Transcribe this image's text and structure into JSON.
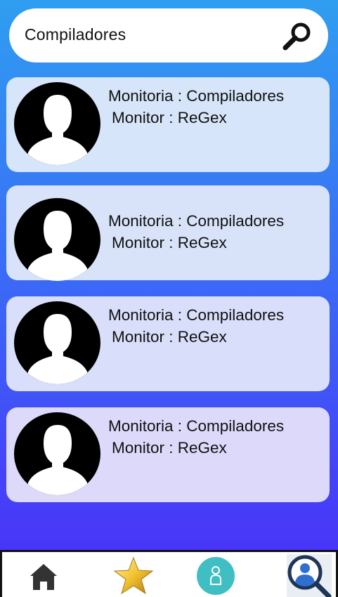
{
  "search": {
    "value": "Compiladores",
    "icon": "search-icon"
  },
  "results": [
    {
      "monitoria": "Monitoria : Compiladores",
      "monitor": "Monitor : ReGex",
      "avatar_icon": "user-avatar-icon"
    },
    {
      "monitoria": "Monitoria : Compiladores",
      "monitor": "Monitor : ReGex",
      "avatar_icon": "user-avatar-icon"
    },
    {
      "monitoria": "Monitoria : Compiladores",
      "monitor": "Monitor : ReGex",
      "avatar_icon": "user-avatar-icon"
    },
    {
      "monitoria": "Monitoria : Compiladores",
      "monitor": "Monitor : ReGex",
      "avatar_icon": "user-avatar-icon"
    }
  ],
  "bottom_nav": {
    "items": [
      "home-icon",
      "star-icon",
      "person-icon",
      "user-search-icon"
    ]
  },
  "colors": {
    "gradient_top": "#2f9ef0",
    "gradient_bottom": "#4b2cf8",
    "card": "#d6e4f8",
    "teal_button": "#3fbfc4"
  }
}
